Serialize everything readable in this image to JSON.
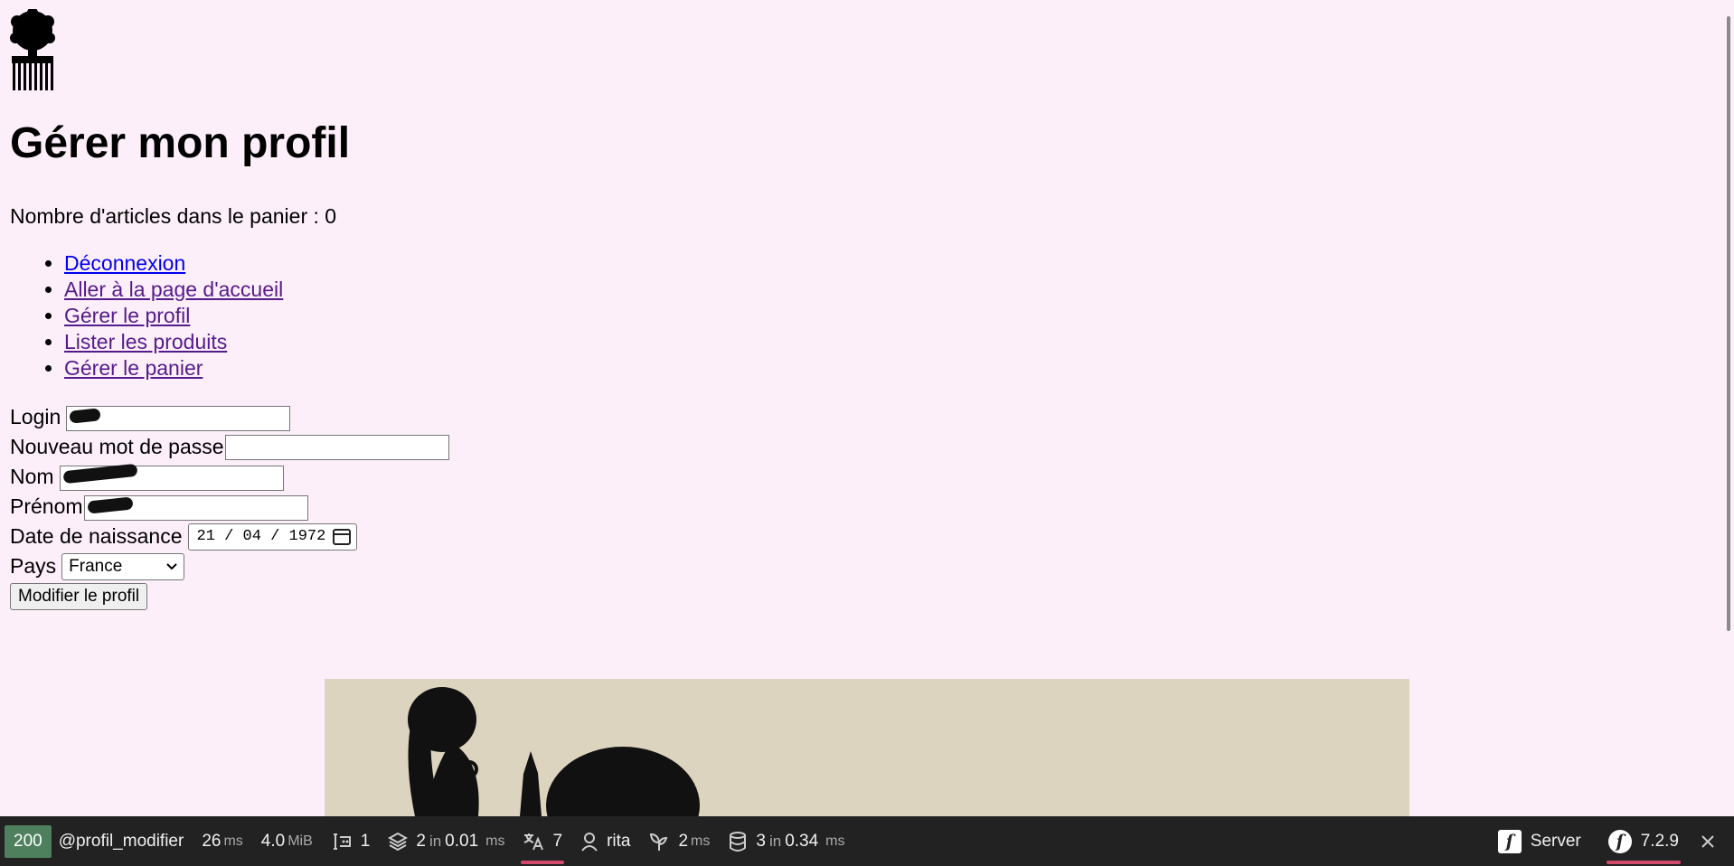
{
  "page": {
    "title": "Gérer mon profil",
    "cart_text": "Nombre d'articles dans le panier : 0"
  },
  "nav": [
    {
      "label": "Déconnexion",
      "visited": false
    },
    {
      "label": "Aller à la page d'accueil",
      "visited": true
    },
    {
      "label": "Gérer le profil",
      "visited": true
    },
    {
      "label": "Lister les produits",
      "visited": true
    },
    {
      "label": "Gérer le panier",
      "visited": true
    }
  ],
  "form": {
    "login_label": "Login",
    "password_label": "Nouveau mot de passe",
    "nom_label": "Nom",
    "prenom_label": "Prénom",
    "birthdate_label": "Date de naissance",
    "birthdate_value": "21 / 04 / 1972",
    "pays_label": "Pays",
    "pays_value": "France",
    "submit_label": "Modifier le profil"
  },
  "toolbar": {
    "status_code": "200",
    "route": "@profil_modifier",
    "time_value": "26",
    "time_unit": "ms",
    "memory_value": "4.0",
    "memory_unit": "MiB",
    "forms_count": "1",
    "templates_count": "2",
    "templates_in": "in",
    "templates_time": "0.01",
    "templates_unit": "ms",
    "translations_count": "7",
    "user": "rita",
    "events_value": "2",
    "events_unit": "ms",
    "db_count": "3",
    "db_in": "in",
    "db_time": "0.34",
    "db_unit": "ms",
    "server_label": "Server",
    "symfony_version": "7.2.9",
    "accent_color": "#4f805d",
    "highlight_color": "#d14a6a"
  },
  "colors": {
    "background": "#fdeffa",
    "toolbar_bg": "#222222",
    "hero_bg": "#ddd4bf"
  }
}
